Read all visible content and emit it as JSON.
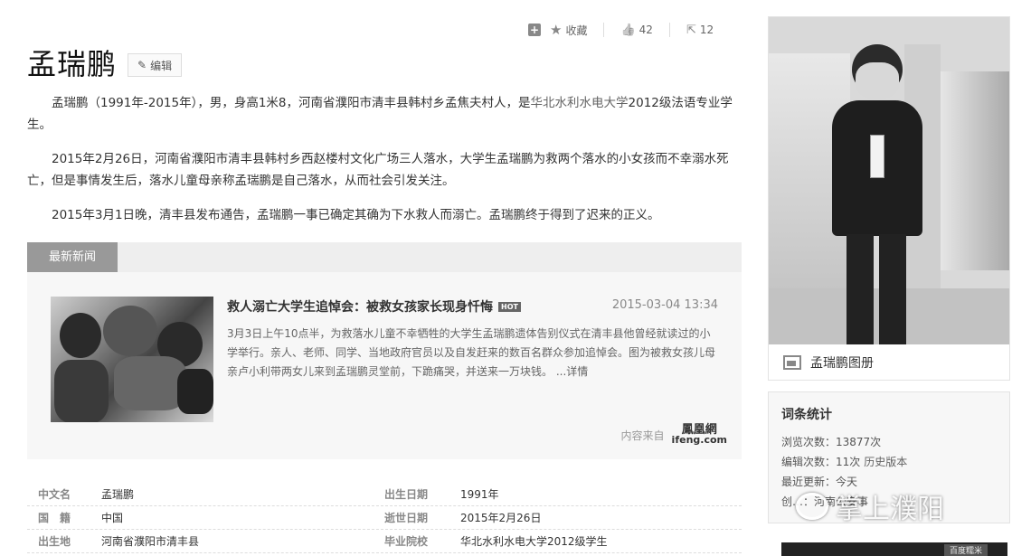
{
  "toolbar": {
    "collect_label": "收藏",
    "like_count": "42",
    "share_count": "12"
  },
  "entry": {
    "title": "孟瑞鹏",
    "edit_label": "编辑"
  },
  "paragraphs": {
    "p1_a": "孟瑞鹏（1991年-2015年），男，身高1米8，河南省濮阳市清丰县韩村乡孟焦夫村人，是",
    "p1_link": "华北水利水电大学",
    "p1_b": "2012级法语专业学生。",
    "p2": "2015年2月26日，河南省濮阳市清丰县韩村乡西赵楼村文化广场三人落水，大学生孟瑞鹏为救两个落水的小女孩而不幸溺水死亡，但是事情发生后，落水儿童母亲称孟瑞鹏是自己落水，从而社会引发关注。",
    "p3": "2015年3月1日晚，清丰县发布通告，孟瑞鹏一事已确定其确为下水救人而溺亡。孟瑞鹏终于得到了迟来的正义。"
  },
  "news": {
    "tab_label": "最新新闻",
    "title": "救人溺亡大学生追悼会：被救女孩家长现身忏悔",
    "hot_badge": "HOT",
    "date": "2015-03-04 13:34",
    "body": "3月3日上午10点半，为救落水儿童不幸牺牲的大学生孟瑞鹏遗体告别仪式在清丰县他曾经就读过的小学举行。亲人、老师、同学、当地政府官员以及自发赶来的数百名群众参加追悼会。图为被救女孩儿母亲卢小利带两女儿来到孟瑞鹏灵堂前，下跪痛哭，并送来一万块钱。",
    "more": "...详情",
    "source_label": "内容来自",
    "source_cn": "鳳凰網",
    "source_en": "ifeng.com"
  },
  "info": [
    {
      "k": "中文名",
      "v": "孟瑞鹏",
      "k2": "出生日期",
      "v2": "1991年"
    },
    {
      "k": "国　籍",
      "v": "中国",
      "k2": "逝世日期",
      "v2": "2015年2月26日"
    },
    {
      "k": "出生地",
      "v": "河南省濮阳市清丰县",
      "k2": "毕业院校",
      "v2": "华北水利水电大学2012级学生"
    }
  ],
  "album": {
    "label": "孟瑞鹏图册"
  },
  "stats": {
    "title": "词条统计",
    "views": "浏览次数：13877次",
    "edits": "编辑次数：11次",
    "history_link": "历史版本",
    "updated": "最近更新：今天",
    "creator": "创…：河南公安事"
  },
  "watermark": {
    "text": "掌上濮阳"
  },
  "bottom_ad": {
    "label": "百度糯米"
  }
}
